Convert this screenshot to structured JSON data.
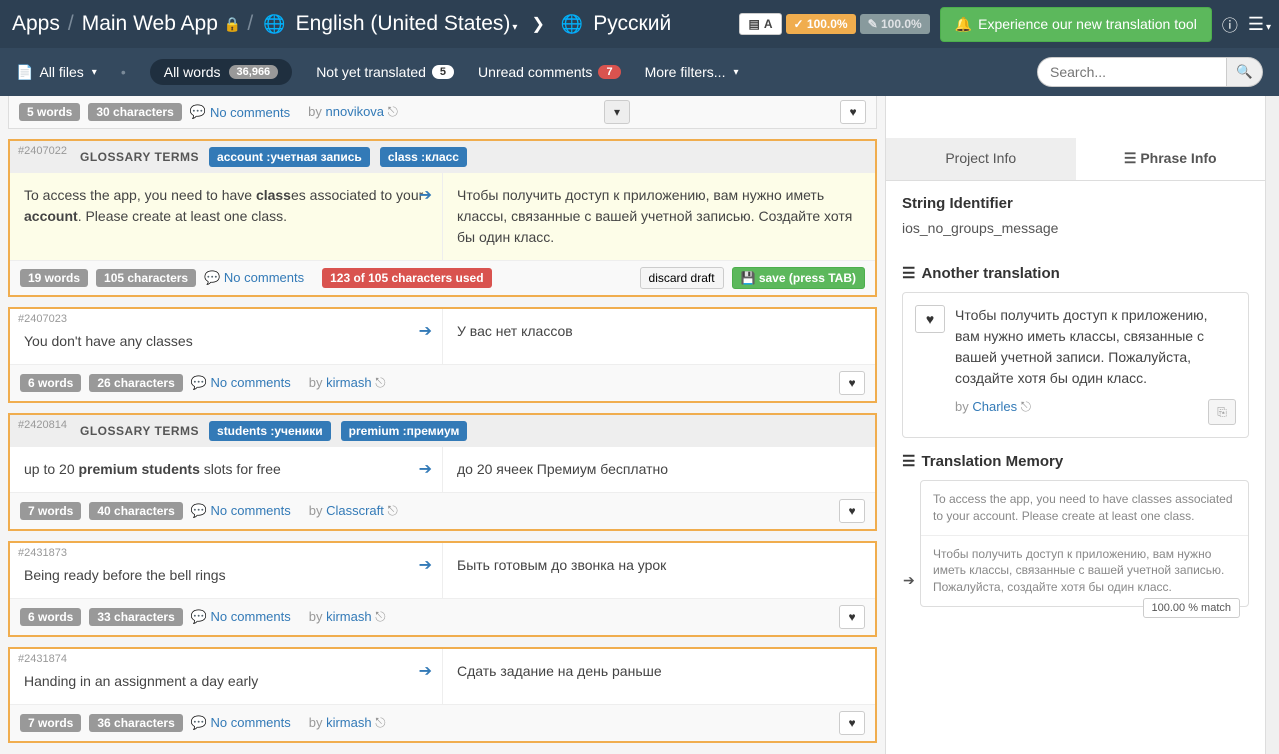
{
  "breadcrumb": {
    "apps": "Apps",
    "project": "Main Web App",
    "source_lang": "English (United States)",
    "target_lang": "Русский"
  },
  "topbar": {
    "badge1": "A",
    "badge2": "✓ 100.0%",
    "badge3": "✎ 100.0%",
    "experience": "Experience our new translation tool"
  },
  "filters": {
    "all_files": "All files",
    "all_words": "All words",
    "all_words_count": "36,966",
    "not_translated": "Not yet translated",
    "not_translated_count": "5",
    "unread": "Unread comments",
    "unread_count": "7",
    "more": "More filters...",
    "search_placeholder": "Search..."
  },
  "partial_top": {
    "words": "5 words",
    "chars": "30 characters",
    "comments": "No comments",
    "by": "by",
    "author": "nnovikova"
  },
  "phrases": [
    {
      "id": "#2407022",
      "glossary_label": "GLOSSARY TERMS",
      "glossary_terms": [
        "account :учетная запись",
        "class :класс"
      ],
      "source_html": "To access the app, you need to have <b>class</b>es associated to your <b>account</b>. Please create at least one class.",
      "target": "Чтобы получить доступ к приложению, вам нужно иметь классы, связанные с вашей учетной записью. Создайте хотя бы один класс.",
      "words": "19 words",
      "chars": "105 characters",
      "comments": "No comments",
      "char_used": "123 of 105 characters used",
      "discard": "discard draft",
      "save": "save (press TAB)",
      "highlighted": true,
      "editing": true
    },
    {
      "id": "#2407023",
      "source_html": "You don't have any classes",
      "target": "У вас нет классов",
      "words": "6 words",
      "chars": "26 characters",
      "comments": "No comments",
      "by": "by",
      "author": "kirmash"
    },
    {
      "id": "#2420814",
      "glossary_label": "GLOSSARY TERMS",
      "glossary_terms": [
        "students :ученики",
        "premium :премиум"
      ],
      "source_html": "up to 20 <b>premium students</b> slots for free",
      "target": "до 20 ячеек Премиум бесплатно",
      "words": "7 words",
      "chars": "40 characters",
      "comments": "No comments",
      "by": "by",
      "author": "Classcraft"
    },
    {
      "id": "#2431873",
      "source_html": "Being ready before the bell rings",
      "target": "Быть готовым до звонка на урок",
      "words": "6 words",
      "chars": "33 characters",
      "comments": "No comments",
      "by": "by",
      "author": "kirmash"
    },
    {
      "id": "#2431874",
      "source_html": "Handing in an assignment a day early",
      "target": "Сдать задание на день раньше",
      "words": "7 words",
      "chars": "36 characters",
      "comments": "No comments",
      "by": "by",
      "author": "kirmash"
    }
  ],
  "sidebar": {
    "tabs": {
      "project": "Project Info",
      "phrase": "Phrase Info"
    },
    "string_id_label": "String Identifier",
    "string_id": "ios_no_groups_message",
    "another_label": "Another translation",
    "another_text": "Чтобы получить доступ к приложению, вам нужно иметь классы, связанные с вашей учетной записи. Пожалуйста, создайте хотя бы один класс.",
    "another_by": "by",
    "another_author": "Charles",
    "tm_label": "Translation Memory",
    "tm_source": "To access the app, you need to have classes associated to your account. Please create at least one class.",
    "tm_target": "Чтобы получить доступ к приложению, вам нужно иметь классы, связанные с вашей учетной записью. Пожалуйста, создайте хотя бы один класс.",
    "match": "100.00 % match"
  }
}
